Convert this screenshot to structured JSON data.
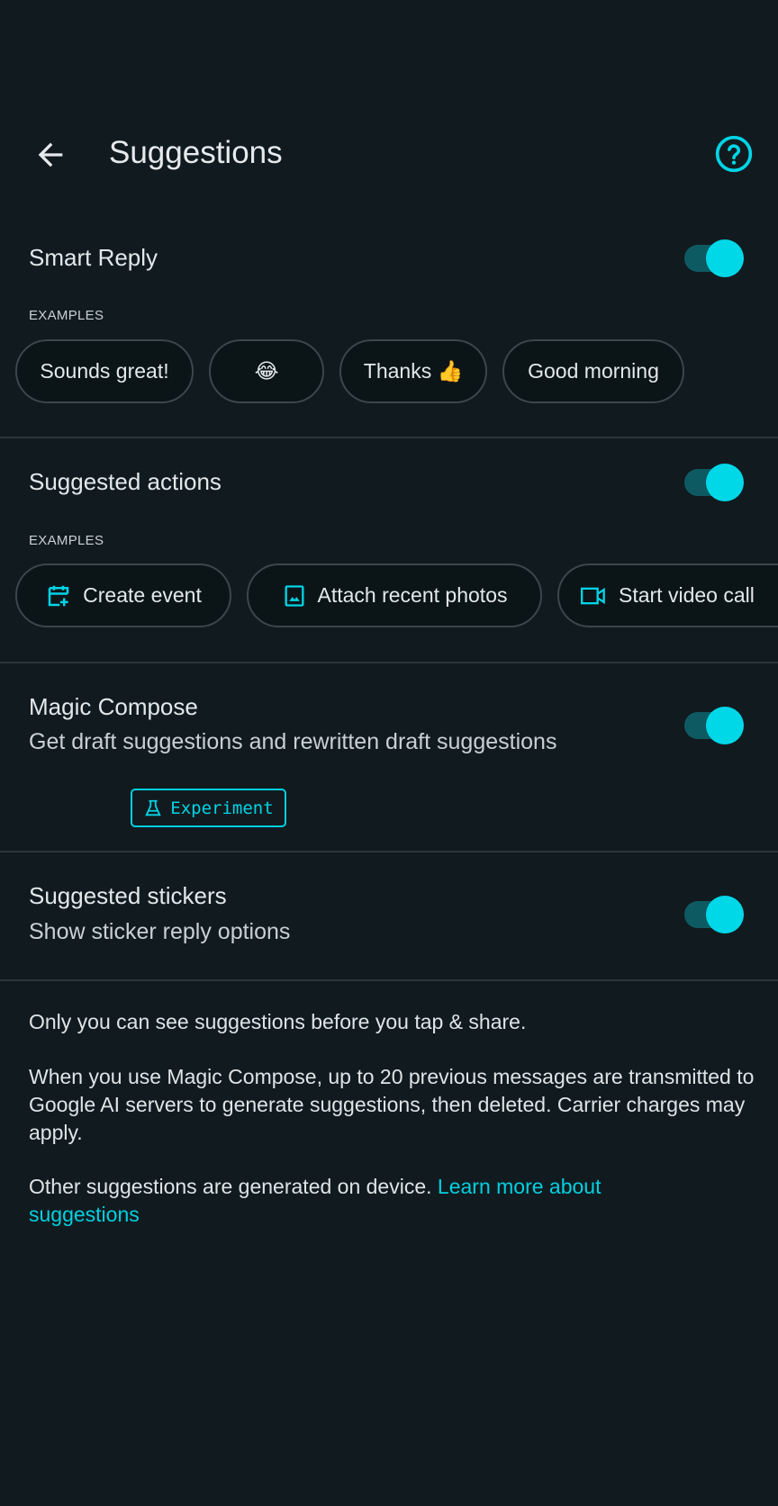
{
  "header": {
    "title": "Suggestions",
    "back_icon": "arrow-left-icon",
    "help_icon": "help-circle-icon"
  },
  "colors": {
    "accent": "#00d8e8",
    "background": "#111b1f",
    "toggle_track": "#0e5a62"
  },
  "smart_reply": {
    "label": "Smart Reply",
    "enabled": true,
    "examples_label": "EXAMPLES",
    "chips": [
      "Sounds great!",
      "😂",
      "Thanks 👍",
      "Good morning"
    ]
  },
  "suggested_actions": {
    "label": "Suggested actions",
    "enabled": true,
    "examples_label": "EXAMPLES",
    "chips": [
      {
        "label": "Create event",
        "icon": "calendar-add-icon"
      },
      {
        "label": "Attach recent photos",
        "icon": "image-icon"
      },
      {
        "label": "Start video call",
        "icon": "video-camera-icon"
      }
    ]
  },
  "magic_compose": {
    "label": "Magic Compose",
    "subtitle": "Get draft suggestions and rewritten draft suggestions",
    "enabled": true,
    "badge": "Experiment",
    "badge_icon": "flask-icon"
  },
  "suggested_stickers": {
    "label": "Suggested stickers",
    "subtitle": "Show sticker reply options",
    "enabled": true
  },
  "footer": {
    "p1": "Only you can see suggestions before you tap & share.",
    "p2": "When you use Magic Compose, up to 20 previous messages are transmitted to Google AI servers to generate suggestions, then deleted. Carrier charges may apply.",
    "p3": "Other suggestions are generated on device.",
    "link": "Learn more about suggestions"
  }
}
